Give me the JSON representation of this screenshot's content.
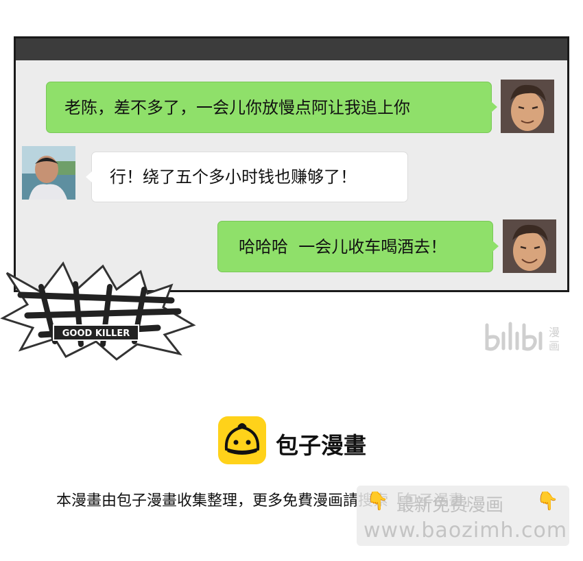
{
  "chat": {
    "messages": [
      {
        "side": "right",
        "text": "老陈，差不多了，一会儿你放慢点阿让我追上你"
      },
      {
        "side": "left",
        "text": "行！绕了五个多小时钱也赚够了！"
      },
      {
        "side": "right",
        "text": "哈哈哈  一会儿收车喝酒去！"
      }
    ]
  },
  "logo": {
    "subtitle": "GOOD KILLER"
  },
  "watermark": {
    "text": "bilibili漫画"
  },
  "brand": {
    "name": "包子漫畫"
  },
  "notice": {
    "text": "本漫畫由包子漫畫收集整理，更多免費漫画請搜索「包子漫畫」"
  },
  "overlay": {
    "line1": "最新免费漫画",
    "line2": "www.baozimh.com",
    "hand_icon": "pointing-down-hand-icon"
  },
  "colors": {
    "bubble_green": "#8fe06a",
    "panel_bg": "#ececec",
    "brand_yellow": "#ffd21a"
  }
}
